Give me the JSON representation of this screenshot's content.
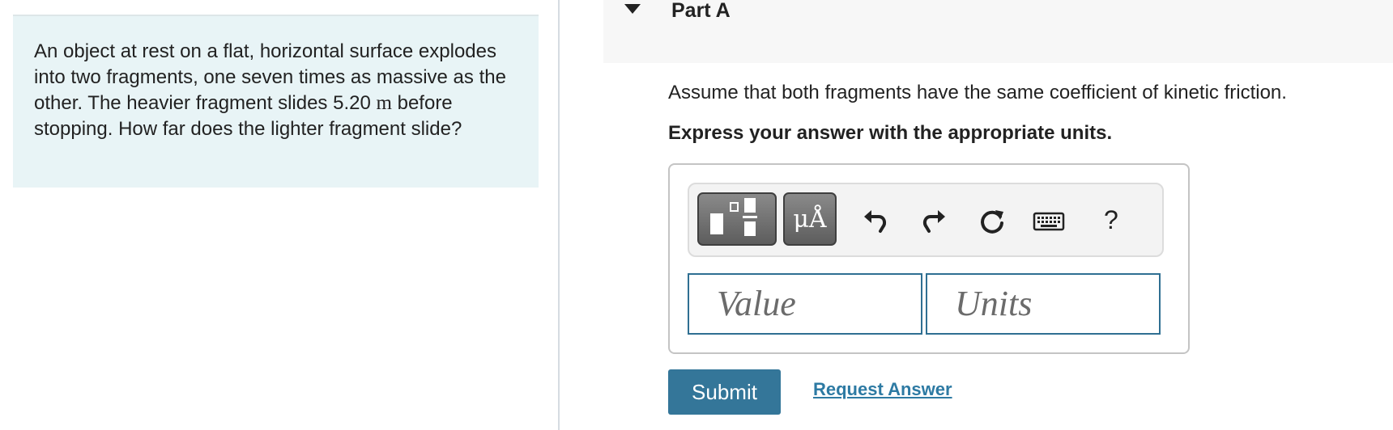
{
  "problem": {
    "text_before_value": "An object at rest on a flat, horizontal surface explodes into two fragments, one seven times as massive as the other. The heavier fragment slides ",
    "value": "5.20",
    "unit": "m",
    "text_after_unit": " before stopping. How far does the lighter fragment slide?"
  },
  "part": {
    "title": "Part A"
  },
  "instruction": "Assume that both fragments have the same coefficient of kinetic friction.",
  "units_instruction": "Express your answer with the appropriate units.",
  "toolbar": {
    "symbols_label": "μÅ",
    "help_label": "?",
    "icons": [
      "templates-icon",
      "undo-icon",
      "redo-icon",
      "reset-icon",
      "keyboard-icon",
      "help-icon"
    ]
  },
  "inputs": {
    "value_placeholder": "Value",
    "units_placeholder": "Units"
  },
  "actions": {
    "submit_label": "Submit",
    "request_answer_label": "Request Answer"
  },
  "colors": {
    "problem_bg": "#e8f4f6",
    "accent": "#347699",
    "link": "#2d7aa3",
    "input_border": "#2f6f92"
  }
}
